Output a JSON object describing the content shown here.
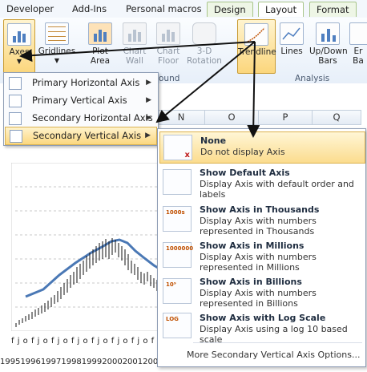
{
  "tabs": {
    "developer": "Developer",
    "addins": "Add-Ins",
    "personal_macros": "Personal macros",
    "design": "Design",
    "layout": "Layout",
    "format": "Format"
  },
  "ribbon": {
    "axes": "Axes",
    "gridlines": "Gridlines",
    "plot_area_1": "Plot",
    "plot_area_2": "Area",
    "chart_wall_1": "Chart",
    "chart_wall_2": "Wall",
    "chart_floor_1": "Chart",
    "chart_floor_2": "Floor",
    "rotation_1": "3-D",
    "rotation_2": "Rotation",
    "trendline": "Trendline",
    "lines": "Lines",
    "updown_1": "Up/Down",
    "updown_2": "Bars",
    "error_1": "Er",
    "error_2": "Ba",
    "group_background": "ound",
    "group_analysis": "Analysis"
  },
  "column_headers": [
    "N",
    "O",
    "P",
    "Q"
  ],
  "axes_menu": {
    "items": [
      {
        "label": "Primary Horizontal Axis"
      },
      {
        "label": "Primary Vertical Axis"
      },
      {
        "label": "Secondary Horizontal Axis"
      },
      {
        "label": "Secondary Vertical Axis"
      }
    ]
  },
  "submenu": {
    "items": [
      {
        "title": "None",
        "desc": "Do not display Axis"
      },
      {
        "title": "Show Default Axis",
        "desc": "Display Axis with default order and labels"
      },
      {
        "title": "Show Axis in Thousands",
        "desc": "Display Axis with numbers represented in Thousands",
        "icon_text": "1000s"
      },
      {
        "title": "Show Axis in Millions",
        "desc": "Display Axis with numbers represented in Millions",
        "icon_text": "1000000"
      },
      {
        "title": "Show Axis in Billions",
        "desc": "Display Axis with numbers represented in Billions",
        "icon_text": "10⁹"
      },
      {
        "title": "Show Axis with Log Scale",
        "desc": "Display Axis using a log 10 based scale",
        "icon_text": "LOG"
      }
    ],
    "more_options": "More Secondary Vertical Axis Options..."
  },
  "chart": {
    "x_letters": "f j o f j o f j o f j o f j o f j o f j o f j",
    "years": "1995199619971998199920002001200"
  },
  "colors": {
    "highlight": "#fbd77f",
    "accent_blue": "#4f7fc0",
    "ribbon_border": "#b9cbe2"
  }
}
